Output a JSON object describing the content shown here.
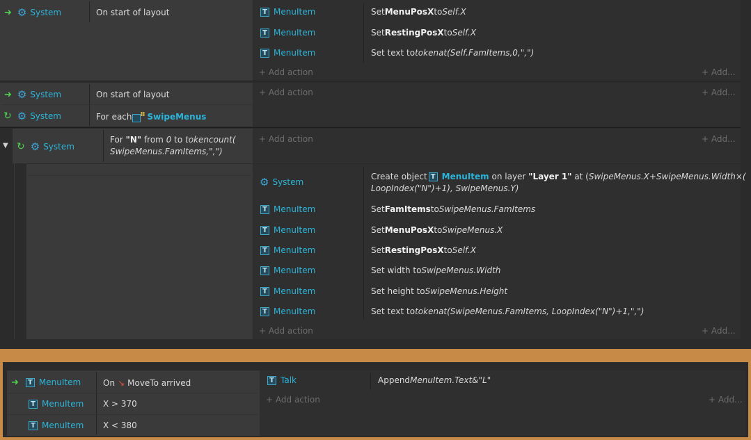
{
  "event1": {
    "cond": {
      "object": "System",
      "text": "On start of layout"
    },
    "actions": [
      {
        "object": "MenuItem",
        "pre": "Set ",
        "bold": "MenuPosX",
        "mid": " to ",
        "italic": "Self.X"
      },
      {
        "object": "MenuItem",
        "pre": "Set ",
        "bold": "RestingPosX",
        "mid": " to ",
        "italic": "Self.X"
      },
      {
        "object": "MenuItem",
        "pre": "Set text to ",
        "italic": "tokenat(Self.FamItems,0,\",\")"
      }
    ]
  },
  "event2": {
    "cond1": {
      "object": "System",
      "text": "On start of layout"
    },
    "cond2": {
      "object": "System",
      "pre": "For each ",
      "family": "SwipeMenus"
    }
  },
  "event3": {
    "cond": {
      "object": "System",
      "pre": "For ",
      "bold": "\"N\"",
      "mid1": " from ",
      "i1": "0",
      "mid2": " to ",
      "i2": "tokencount(",
      "line2": "SwipeMenus.FamItems,\",\")"
    }
  },
  "event4": {
    "create": {
      "object": "System",
      "pre": "Create object ",
      "obj": "MenuItem",
      "mid": " on layer ",
      "bold": "\"Layer 1\"",
      "mid2": " at (",
      "italic": "SwipeMenus.X+SwipeMenus.Width×(",
      "line2": "LoopIndex(\"N\")+1), SwipeMenus.Y)"
    },
    "actions": [
      {
        "object": "MenuItem",
        "pre": "Set ",
        "bold": "FamItems",
        "mid": " to ",
        "italic": "SwipeMenus.FamItems"
      },
      {
        "object": "MenuItem",
        "pre": "Set ",
        "bold": "MenuPosX",
        "mid": " to ",
        "italic": "SwipeMenus.X"
      },
      {
        "object": "MenuItem",
        "pre": "Set ",
        "bold": "RestingPosX",
        "mid": " to ",
        "italic": "Self.X"
      },
      {
        "object": "MenuItem",
        "pre": "Set width to ",
        "italic": "SwipeMenus.Width"
      },
      {
        "object": "MenuItem",
        "pre": "Set height to ",
        "italic": "SwipeMenus.Height"
      },
      {
        "object": "MenuItem",
        "pre": "Set text to ",
        "italic": "tokenat(SwipeMenus.FamItems, LoopIndex(\"N\")+1,\",\")"
      }
    ]
  },
  "event5": {
    "conds": [
      {
        "object": "MenuItem",
        "pre": "On ",
        "text": "MoveTo arrived"
      },
      {
        "object": "MenuItem",
        "text": "X > 370"
      },
      {
        "object": "MenuItem",
        "text": "X < 380"
      }
    ],
    "action": {
      "object": "Talk",
      "pre": "Append ",
      "italic": "MenuItem.Text&\"L\""
    }
  },
  "ui": {
    "add_action": "Add action",
    "add_more": "Add...",
    "plus": "+"
  },
  "icons": {
    "event_trigger": "green-arrow-icon",
    "loop": "loop-icon",
    "system": "gear-icon",
    "sprite": "sprite-icon",
    "family": "family-icon",
    "move": "moveto-icon",
    "collapse": "collapse-triangle-icon"
  },
  "colors": {
    "object_name": "#2bb4d9",
    "separator": "#c88a47",
    "trigger_icon": "#4fd04f"
  }
}
